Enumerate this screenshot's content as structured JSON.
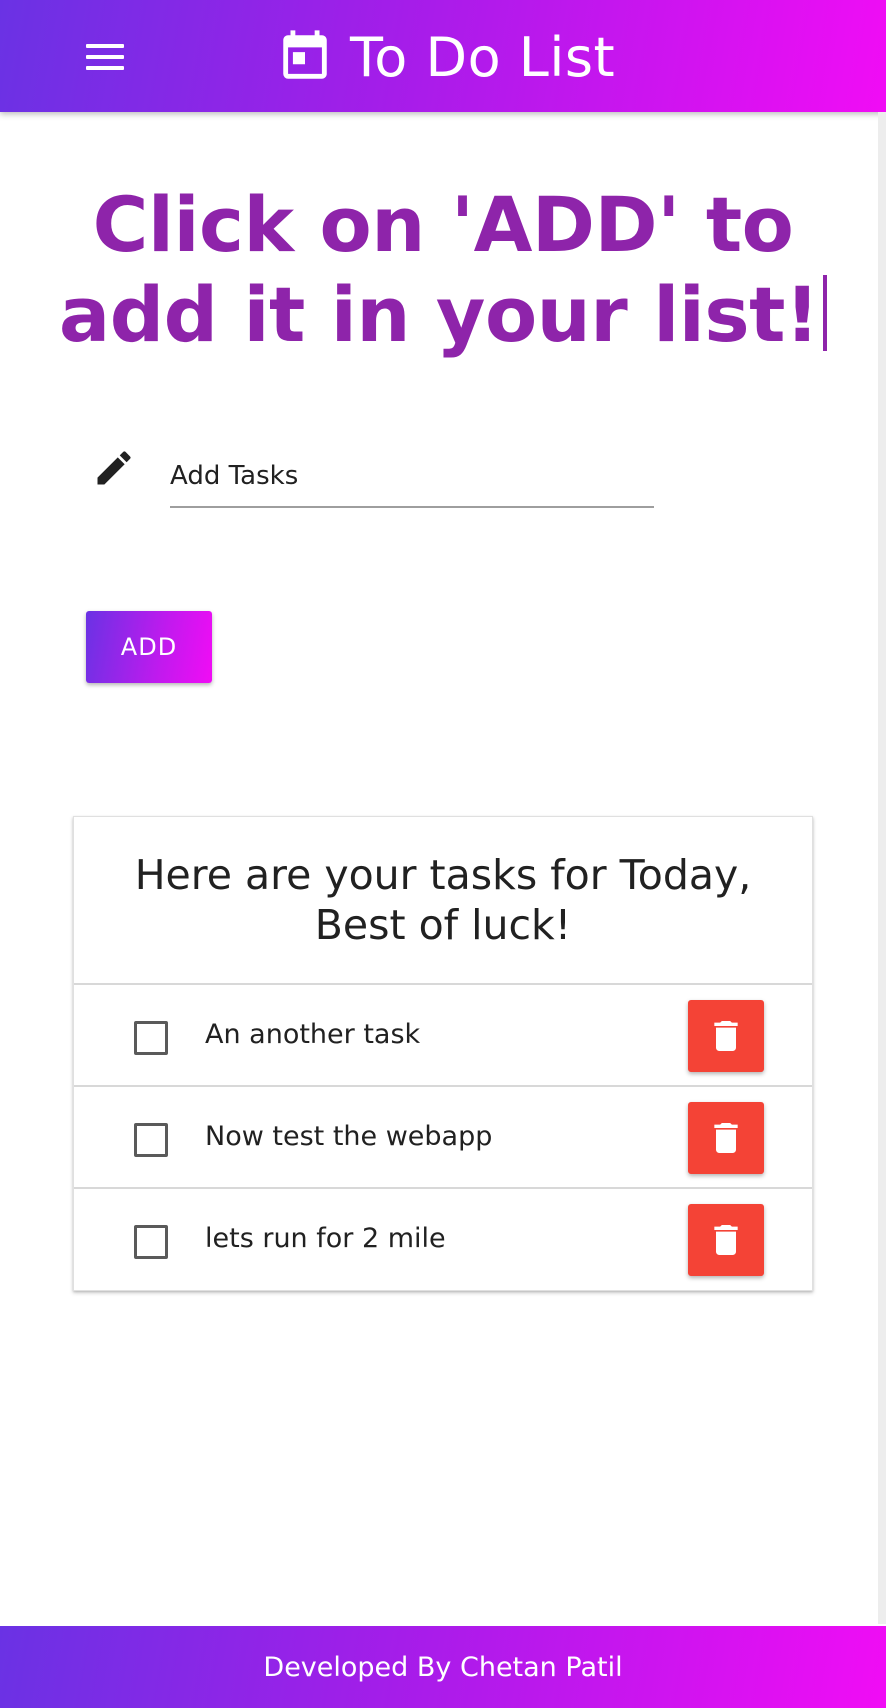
{
  "header": {
    "title": "To Do List",
    "menu_icon": "hamburger-menu-icon",
    "brand_icon": "calendar-icon"
  },
  "main": {
    "heading": "Click on 'ADD' to add it in your list!",
    "input": {
      "icon": "pencil-icon",
      "value": "",
      "placeholder": "Add Tasks"
    },
    "add_button_label": "ADD"
  },
  "tasks_card": {
    "title": "Here are your tasks for Today, Best of luck!",
    "items": [
      {
        "text": "An another task",
        "checked": false
      },
      {
        "text": "Now test the webapp",
        "checked": false
      },
      {
        "text": "lets run for 2 mile",
        "checked": false
      }
    ],
    "delete_icon": "trash-icon"
  },
  "footer": {
    "text": "Developed By Chetan Patil"
  },
  "colors": {
    "gradient_start": "#6a32e4",
    "gradient_end": "#f10cf5",
    "heading": "#8e24aa",
    "delete": "#f44336"
  }
}
